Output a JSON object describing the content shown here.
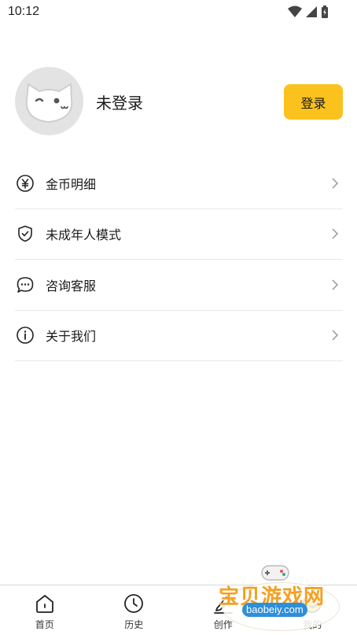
{
  "status_bar": {
    "time": "10:12",
    "icons": [
      "wifi-icon",
      "signal-icon",
      "battery-charging-icon"
    ]
  },
  "profile": {
    "avatar_icon": "cat-avatar-icon",
    "username": "未登录",
    "login_label": "登录"
  },
  "menu": {
    "items": [
      {
        "icon": "coin-icon",
        "label": "金币明细"
      },
      {
        "icon": "shield-check-icon",
        "label": "未成年人模式"
      },
      {
        "icon": "chat-bubble-icon",
        "label": "咨询客服"
      },
      {
        "icon": "info-icon",
        "label": "关于我们"
      }
    ]
  },
  "tabs": [
    {
      "icon": "home-icon",
      "label": "首页"
    },
    {
      "icon": "clock-icon",
      "label": "历史"
    },
    {
      "icon": "pen-icon",
      "label": "创作"
    },
    {
      "icon": "smile-icon",
      "label": "我的"
    }
  ],
  "watermark": {
    "title": "宝贝游戏网",
    "url": "baobeiy.com"
  },
  "colors": {
    "accent": "#fbc21d",
    "divider": "#e8e8e8",
    "avatar_bg": "#e3e3e3"
  }
}
